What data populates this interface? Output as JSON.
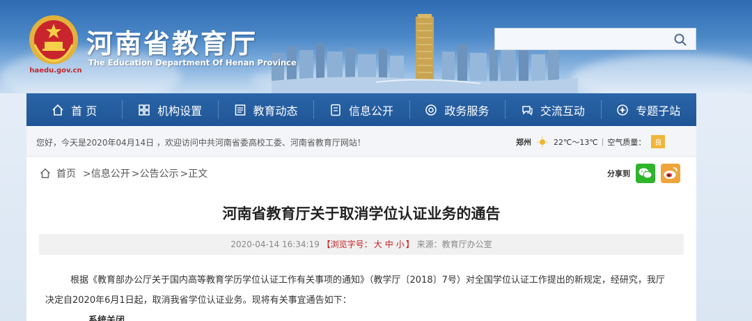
{
  "header": {
    "title": "河南省教育厅",
    "title_en": "The Education Department Of Henan Province",
    "domain": "haedu.gov.cn",
    "search_placeholder": ""
  },
  "nav": {
    "items": [
      {
        "label": "首 页",
        "icon": "home-icon"
      },
      {
        "label": "机构设置",
        "icon": "org-icon"
      },
      {
        "label": "教育动态",
        "icon": "news-icon"
      },
      {
        "label": "信息公开",
        "icon": "info-icon"
      },
      {
        "label": "政务服务",
        "icon": "service-icon"
      },
      {
        "label": "交流互动",
        "icon": "interaction-icon"
      },
      {
        "label": "专题子站",
        "icon": "topic-icon"
      }
    ]
  },
  "welcome": {
    "text": "您好，今天是2020年04月14日 ，欢迎访问中共河南省委高校工委、河南省教育厅网站！",
    "city": "郑州",
    "temperature": "22℃～13℃",
    "air_quality_label": "空气质量：",
    "air_quality_value": "良"
  },
  "breadcrumb": {
    "home": "首页",
    "item1": ">信息公开",
    "item2": ">公告公示",
    "item3": ">正文"
  },
  "share": {
    "label": "分享到"
  },
  "article": {
    "title": "河南省教育厅关于取消学位认证业务的通告",
    "date": "2020-04-14 16:34:19",
    "font_prefix": "【浏览字号：",
    "font_large": "大",
    "font_medium": "中",
    "font_small": "小",
    "font_suffix": "】",
    "source": "来源：教育厅办公室",
    "paragraph1": "根据《教育部办公厅关于国内高等教育学历学位认证工作有关事项的通知》（教学厅〔2018〕7号）对全国学位认证工作提出的新规定，经研究，我厅决定自2020年6月1日起，取消我省学位认证业务。现将有关事宜通告如下：",
    "partial_line": "系统关闭"
  },
  "colors": {
    "nav_bg": "#1f5595",
    "accent_red": "#c81e1e",
    "wechat": "#2eb52a",
    "weibo": "#f0a53a"
  }
}
